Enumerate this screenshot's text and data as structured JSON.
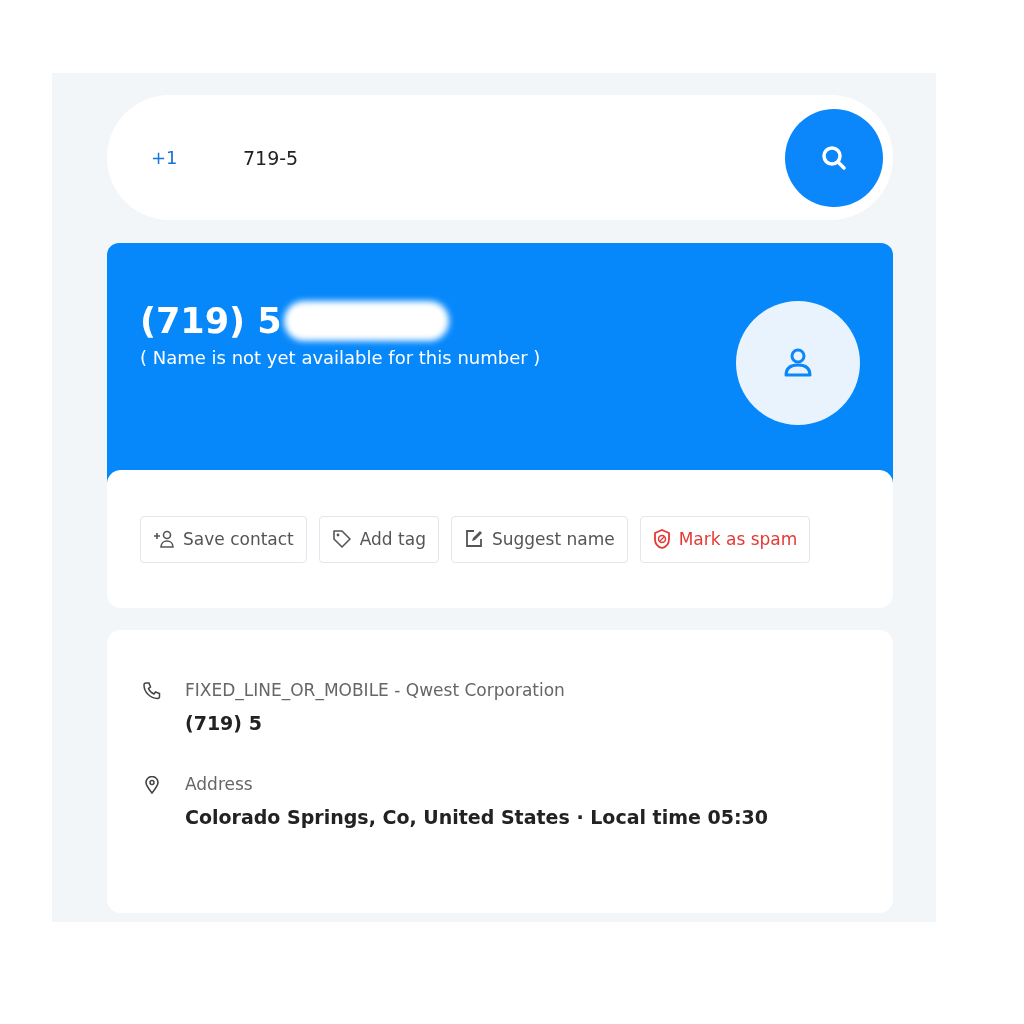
{
  "search": {
    "country_code": "+1",
    "value": "719-5"
  },
  "header": {
    "number": "(719) 5",
    "note": "( Name is not yet available for this number )"
  },
  "actions": [
    {
      "label": "Save contact",
      "kind": "save"
    },
    {
      "label": "Add tag",
      "kind": "tag"
    },
    {
      "label": "Suggest name",
      "kind": "suggest"
    },
    {
      "label": "Mark as spam",
      "kind": "spam"
    }
  ],
  "details": [
    {
      "kind": "phone",
      "label": "FIXED_LINE_OR_MOBILE - Qwest Corporation",
      "value": "(719) 5"
    },
    {
      "kind": "address",
      "label": "Address",
      "value": "Colorado Springs, Co, United States · Local time 05:30"
    }
  ]
}
